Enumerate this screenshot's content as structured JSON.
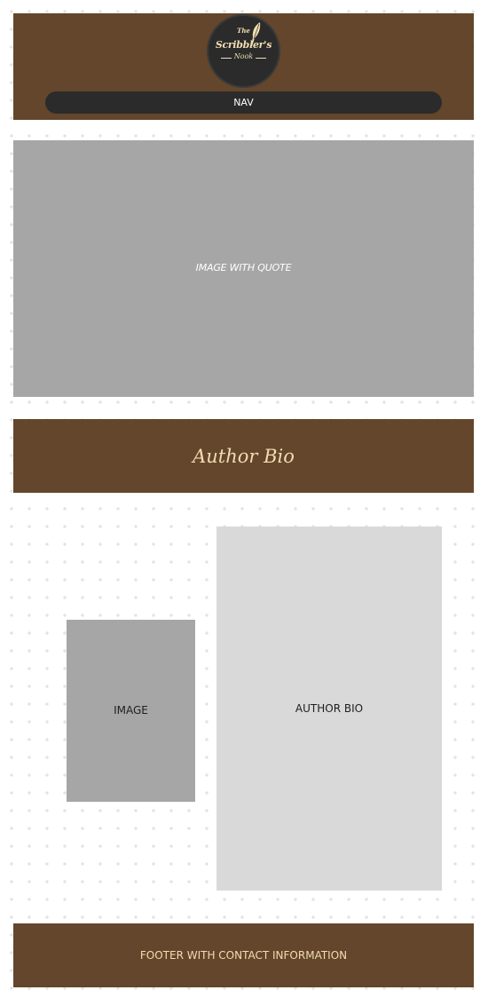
{
  "header": {
    "logo": {
      "line1": "The",
      "line2": "Scribbler's",
      "line3": "Nook",
      "icon": "quill-icon"
    },
    "nav_label": "NAV"
  },
  "hero": {
    "label": "IMAGE WITH QUOTE"
  },
  "author_section": {
    "title": "Author Bio",
    "image_label": "IMAGE",
    "bio_label": "AUTHOR BIO"
  },
  "footer": {
    "label": "FOOTER WITH CONTACT INFORMATION"
  },
  "colors": {
    "brown": "#63462b",
    "cream": "#f1ddb2",
    "dark": "#2b2b2b",
    "gray": "#a6a6a6",
    "light_gray": "#d9d9d9"
  }
}
